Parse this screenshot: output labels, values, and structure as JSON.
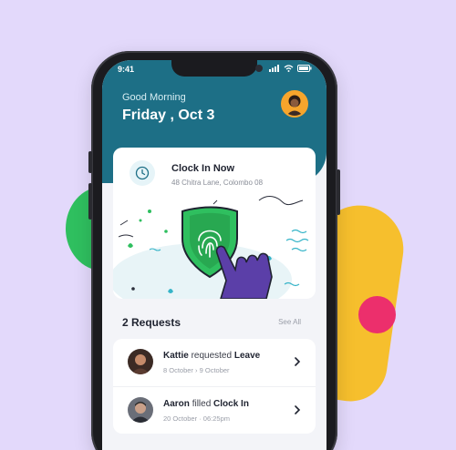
{
  "status_bar": {
    "time": "9:41"
  },
  "header": {
    "greeting": "Good Morning",
    "date": "Friday , Oct 3"
  },
  "clock_card": {
    "title": "Clock In Now",
    "address": "48 Chitra Lane, Colombo 08"
  },
  "requests": {
    "heading": "2 Requests",
    "see_all": "See All",
    "items": [
      {
        "name": "Kattie",
        "action": "requested",
        "type": "Leave",
        "from": "8 October",
        "sep": "›",
        "to": "9 October"
      },
      {
        "name": "Aaron",
        "action": "filled",
        "type": "Clock In",
        "from": "20 October",
        "sep": "·",
        "to": "06:25pm"
      }
    ]
  },
  "colors": {
    "header": "#1d6f86",
    "accent_green": "#2fbf5f",
    "accent_yellow": "#f6bf2d",
    "accent_pink": "#ec2f6c",
    "background": "#e3d9fb"
  }
}
